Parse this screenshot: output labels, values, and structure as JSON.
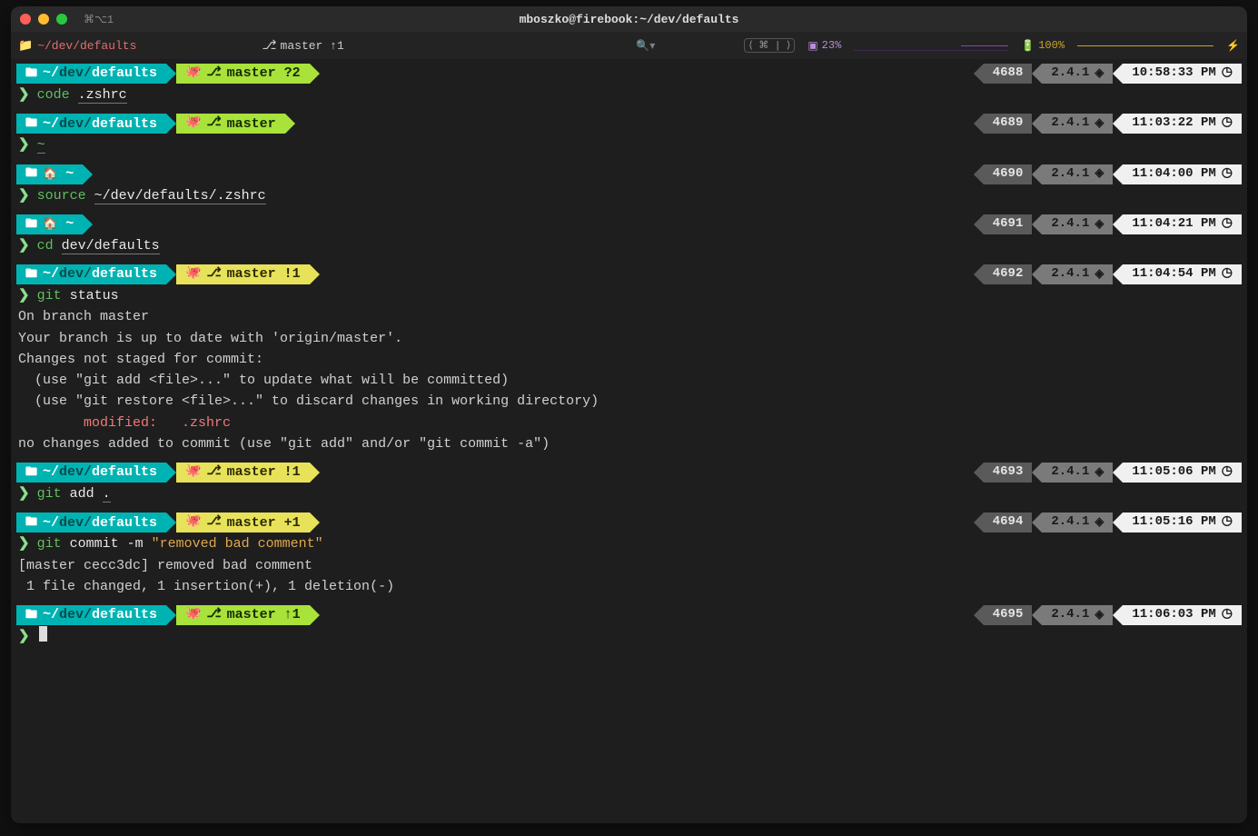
{
  "titlebar": {
    "left_tag": "⌘⌥1",
    "title": "mboszko@firebook:~/dev/defaults"
  },
  "toolbar": {
    "path": "~/dev/defaults",
    "branch": "master ↑1",
    "keyshort": "⟨ ⌘ | ⟩",
    "cpu_pct": "23%",
    "batt_pct": "100%",
    "bolt": "⚡"
  },
  "entries": [
    {
      "path_html": "~/<span class='dim'>dev/</span><b>defaults</b>",
      "branch_seg": "lime",
      "branch_label": "master ?2",
      "job": "4688",
      "ruby": "2.4.1",
      "time": "10:58:33 PM",
      "cmd_html": "<span class='c-green'>code</span> <span class='c-white underline'>.zshrc</span>",
      "out": []
    },
    {
      "path_html": "~/<span class='dim'>dev/</span><b>defaults</b>",
      "branch_seg": "lime",
      "branch_label": "master",
      "job": "4689",
      "ruby": "2.4.1",
      "time": "11:03:22 PM",
      "cmd_html": "<span class='c-green underline'>~</span>",
      "out": []
    },
    {
      "path_html": "<span class='home-ico'>🏠</span> ~",
      "no_branch": true,
      "job": "4690",
      "ruby": "2.4.1",
      "time": "11:04:00 PM",
      "cmd_html": "<span class='c-green'>source</span> <span class='c-white underline'>~/dev/defaults/.zshrc</span>",
      "out": []
    },
    {
      "path_html": "<span class='home-ico'>🏠</span> ~",
      "no_branch": true,
      "job": "4691",
      "ruby": "2.4.1",
      "time": "11:04:21 PM",
      "cmd_html": "<span class='c-green'>cd</span> <span class='c-white underline'>dev/defaults</span>",
      "out": []
    },
    {
      "path_html": "~/<span class='dim'>dev/</span><b>defaults</b>",
      "branch_seg": "yellow",
      "branch_label": "master !1",
      "job": "4692",
      "ruby": "2.4.1",
      "time": "11:04:54 PM",
      "cmd_html": "<span class='c-green'>git</span> <span class='c-white'>status</span>",
      "out": [
        "On branch master",
        "Your branch is up to date with 'origin/master'.",
        "",
        "Changes not staged for commit:",
        "  (use \"git add <file>...\" to update what will be committed)",
        "  (use \"git restore <file>...\" to discard changes in working directory)",
        "        <span class='mod'>modified:   .zshrc</span>",
        "",
        "no changes added to commit (use \"git add\" and/or \"git commit -a\")"
      ]
    },
    {
      "path_html": "~/<span class='dim'>dev/</span><b>defaults</b>",
      "branch_seg": "yellow",
      "branch_label": "master !1",
      "job": "4693",
      "ruby": "2.4.1",
      "time": "11:05:06 PM",
      "cmd_html": "<span class='c-green'>git</span> <span class='c-white'>add <span class='underline'>.</span></span>",
      "out": []
    },
    {
      "path_html": "~/<span class='dim'>dev/</span><b>defaults</b>",
      "branch_seg": "yellow",
      "branch_label": "master +1",
      "job": "4694",
      "ruby": "2.4.1",
      "time": "11:05:16 PM",
      "cmd_html": "<span class='c-green'>git</span> <span class='c-white'>commit -m </span><span class='c-orange'>\"removed bad comment\"</span>",
      "out": [
        "[master cecc3dc] removed bad comment",
        " 1 file changed, 1 insertion(+), 1 deletion(-)"
      ]
    },
    {
      "path_html": "~/<span class='dim'>dev/</span><b>defaults</b>",
      "branch_seg": "lime",
      "branch_label": "master ↑1",
      "job": "4695",
      "ruby": "2.4.1",
      "time": "11:06:03 PM",
      "cmd_html": "<span class='cursor'></span>",
      "out": []
    }
  ]
}
